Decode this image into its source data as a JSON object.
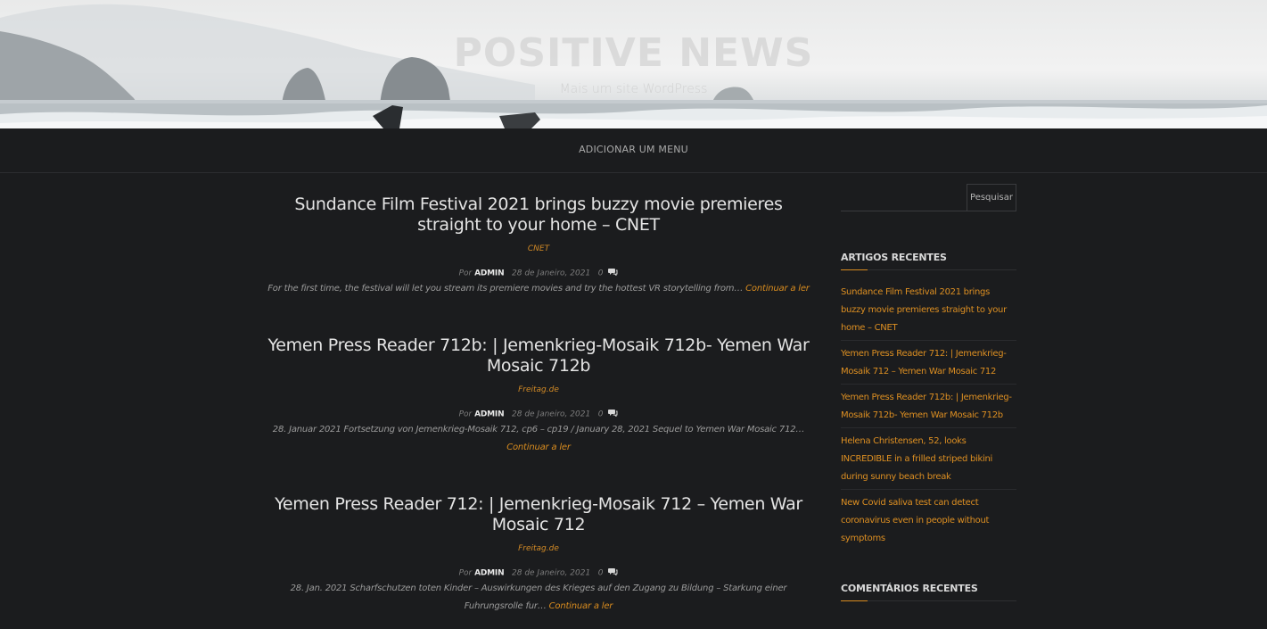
{
  "header": {
    "site_title": "POSITIVE NEWS",
    "tagline": "Mais um site WordPress"
  },
  "menu": {
    "add_menu_label": "ADICIONAR UM MENU"
  },
  "posts": [
    {
      "title": "Sundance Film Festival 2021 brings buzzy movie premieres straight to your home – CNET",
      "category": "CNET",
      "by": "Por",
      "author": "ADMIN",
      "date": "28 de Janeiro, 2021",
      "comments": "0",
      "excerpt": "For the first time, the festival will let you stream its premiere movies and try the hottest VR storytelling from…",
      "read_more": "Continuar a ler"
    },
    {
      "title": "Yemen Press Reader 712b: | Jemenkrieg-Mosaik 712b- Yemen War Mosaic 712b",
      "category": "Freitag.de",
      "by": "Por",
      "author": "ADMIN",
      "date": "28 de Janeiro, 2021",
      "comments": "0",
      "excerpt": "28. Januar 2021 Fortsetzung von Jemenkrieg-Mosaik 712, cp6 – cp19 / January 28, 2021 Sequel to Yemen War Mosaic 712…",
      "read_more": "Continuar a ler"
    },
    {
      "title": "Yemen Press Reader 712: | Jemenkrieg-Mosaik 712 – Yemen War Mosaic 712",
      "category": "Freitag.de",
      "by": "Por",
      "author": "ADMIN",
      "date": "28 de Janeiro, 2021",
      "comments": "0",
      "excerpt": "28. Jan. 2021 Scharfschutzen toten Kinder – Auswirkungen des Krieges auf den Zugang zu Bildung – Starkung einer Fuhrungsrolle fur…",
      "read_more": "Continuar a ler"
    }
  ],
  "sidebar": {
    "search_placeholder": "",
    "search_button": "Pesquisar",
    "recent_posts_title": "ARTIGOS RECENTES",
    "recent_posts": [
      "Sundance Film Festival 2021 brings buzzy movie premieres straight to your home – CNET",
      "Yemen Press Reader 712: | Jemenkrieg-Mosaik 712 – Yemen War Mosaic 712",
      "Yemen Press Reader 712b: | Jemenkrieg-Mosaik 712b- Yemen War Mosaic 712b",
      "Helena Christensen, 52, looks INCREDIBLE in a frilled striped bikini during sunny beach break",
      "New Covid saliva test can detect coronavirus even in people without symptoms"
    ],
    "recent_comments_title": "COMENTÁRIOS RECENTES"
  },
  "colors": {
    "background": "#1b1c1e",
    "accent": "#d98c1f"
  }
}
